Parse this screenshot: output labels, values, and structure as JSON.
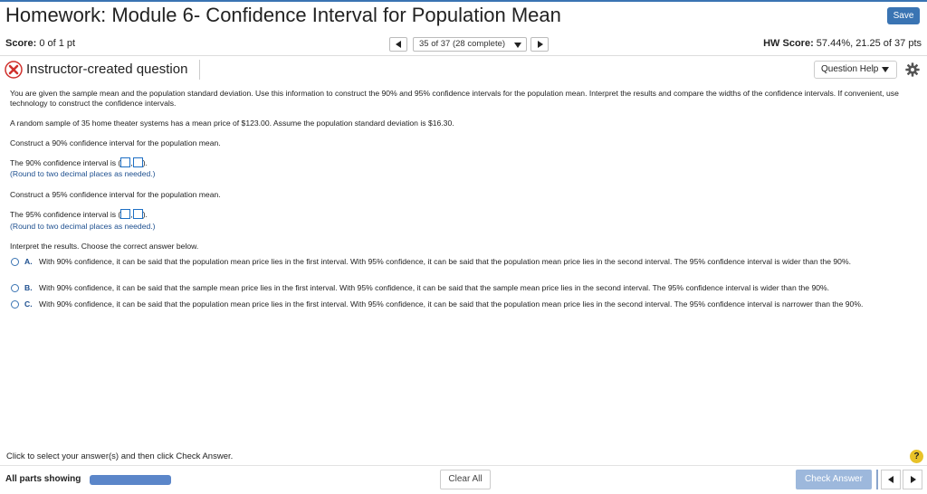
{
  "header": {
    "title": "Homework: Module 6- Confidence Interval for Population Mean",
    "save_label": "Save"
  },
  "scorebar": {
    "score_label": "Score:",
    "score_value": "0 of 1 pt",
    "nav_text": "35 of 37 (28 complete)",
    "hw_score_label": "HW Score:",
    "hw_score_value": "57.44%, 21.25 of 37 pts"
  },
  "question": {
    "type_label": "Instructor-created question",
    "help_label": "Question Help",
    "intro": "You are given the sample mean and the population standard deviation. Use this information to construct the 90% and 95% confidence intervals for the population mean. Interpret the results and compare the widths of the confidence intervals. If convenient, use technology to construct the confidence intervals.",
    "sample_text": "A random sample of 35 home theater systems has a mean price of $123.00. Assume the population standard deviation is $16.30.",
    "part1_prompt": "Construct a 90% confidence interval for the population mean.",
    "part1_answer_prefix": "The 90% confidence interval is (",
    "part1_answer_suffix": ").",
    "part1_hint": "(Round to two decimal places as needed.)",
    "part2_prompt": "Construct a 95% confidence interval for the population mean.",
    "part2_answer_prefix": "The 95% confidence interval is (",
    "part2_answer_suffix": ").",
    "part2_hint": "(Round to two decimal places as needed.)",
    "interpret_prompt": "Interpret the results. Choose the correct answer below.",
    "options": [
      {
        "letter": "A.",
        "text": "With 90% confidence, it can be said that the population mean price lies in the first interval. With 95% confidence, it can be said that the population mean price lies in the second interval. The 95% confidence interval is wider than the 90%."
      },
      {
        "letter": "B.",
        "text": "With 90% confidence, it can be said that the sample mean price lies in the first interval. With 95% confidence, it can be said that the sample mean price lies in the second interval. The 95% confidence interval is wider than the 90%."
      },
      {
        "letter": "C.",
        "text": "With 90% confidence, it can be said that the population mean price lies in the first interval. With 95% confidence, it can be said that the population mean price lies in the second interval. The 95% confidence interval is narrower than the 90%."
      }
    ]
  },
  "footer": {
    "hint": "Click to select your answer(s) and then click Check Answer.",
    "help_icon_glyph": "?",
    "all_parts_label": "All parts showing",
    "clear_label": "Clear All",
    "check_label": "Check Answer"
  },
  "colors": {
    "accent": "#3a74b3",
    "link_blue": "#1d4f8f",
    "error_red": "#d0312d",
    "help_yellow": "#e8c228"
  }
}
